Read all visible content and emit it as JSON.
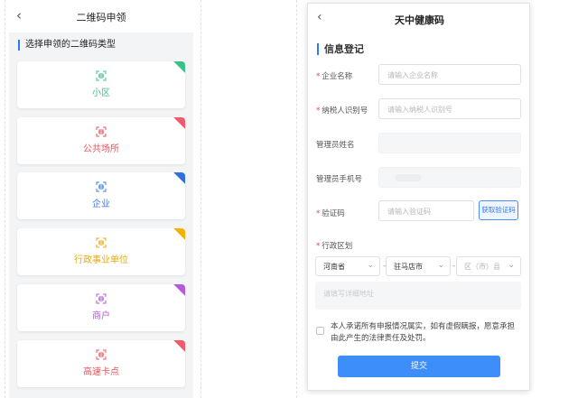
{
  "left": {
    "back_icon": "chevron-left-icon",
    "title": "二维码申领",
    "section_title": "选择申领的二维码类型",
    "cards": [
      {
        "label": "小区",
        "color": "#3cc08a",
        "corner": "#3cc08a"
      },
      {
        "label": "公共场所",
        "color": "#e8545c",
        "corner": "#f05b6c"
      },
      {
        "label": "企业",
        "color": "#3b7be6",
        "corner": "#2f6fe0"
      },
      {
        "label": "行政事业单位",
        "color": "#e8a812",
        "corner": "#f2b300"
      },
      {
        "label": "商户",
        "color": "#b35ad6",
        "corner": "#b45bdc"
      },
      {
        "label": "高速卡点",
        "color": "#e8545c",
        "corner": "#f05b6c"
      }
    ]
  },
  "right": {
    "back_icon": "chevron-left-icon",
    "title": "天中健康码",
    "section_title": "信息登记",
    "fields": {
      "company_name": {
        "label": "企业名称",
        "placeholder": "请输入企业名称",
        "required": "*"
      },
      "tax_id": {
        "label": "纳税人识别号",
        "placeholder": "请输入纳税人识别号",
        "required": "*"
      },
      "admin_name": {
        "label": "管理员姓名"
      },
      "admin_phone": {
        "label": "管理员手机号"
      },
      "verify_code": {
        "label": "验证码",
        "placeholder": "请输入验证码",
        "required": "*",
        "button": "获取验证码"
      },
      "region": {
        "label": "行政区划",
        "required": "*",
        "province": "河南省",
        "city": "驻马店市",
        "county": "区（市）县",
        "address_placeholder": "请填写详细地址"
      }
    },
    "agreement": "本人承诺所有申报情况属实，如有虚假瞒报，愿意承担由此产生的法律责任及处罚。",
    "submit": "提交"
  }
}
